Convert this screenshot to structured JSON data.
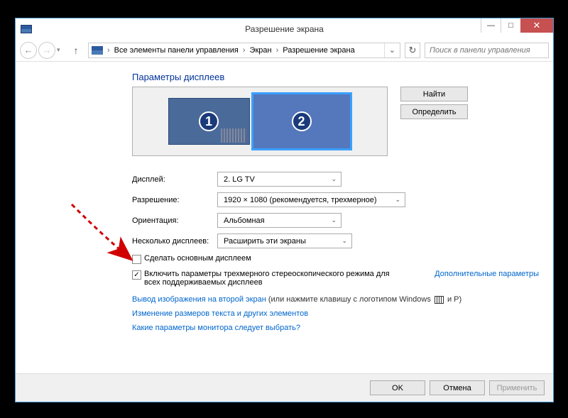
{
  "window": {
    "title": "Разрешение экрана",
    "minimize": "—",
    "maximize": "□",
    "close": "✕"
  },
  "breadcrumb": {
    "item1": "Все элементы панели управления",
    "item2": "Экран",
    "item3": "Разрешение экрана",
    "sep": "›"
  },
  "search": {
    "placeholder": "Поиск в панели управления"
  },
  "heading": "Параметры дисплеев",
  "monitors": {
    "num1": "1",
    "num2": "2"
  },
  "side": {
    "find": "Найти",
    "detect": "Определить"
  },
  "form": {
    "display_label": "Дисплей:",
    "display_value": "2. LG TV",
    "resolution_label": "Разрешение:",
    "resolution_value": "1920 × 1080 (рекомендуется, трехмерное)",
    "orientation_label": "Ориентация:",
    "orientation_value": "Альбомная",
    "multi_label": "Несколько дисплеев:",
    "multi_value": "Расширить эти экраны"
  },
  "checks": {
    "primary": "Сделать основным дисплеем",
    "stereo": "Включить параметры трехмерного стереоскопического режима для всех поддерживаемых дисплеев",
    "extra_link": "Дополнительные параметры"
  },
  "links": {
    "l1a": "Вывод изображения на второй экран",
    "l1b": " (или нажмите клавишу с логотипом Windows ",
    "l1c": " и P)",
    "l2": "Изменение размеров текста и других элементов",
    "l3": "Какие параметры монитора следует выбрать?"
  },
  "footer": {
    "ok": "OK",
    "cancel": "Отмена",
    "apply": "Применить"
  }
}
